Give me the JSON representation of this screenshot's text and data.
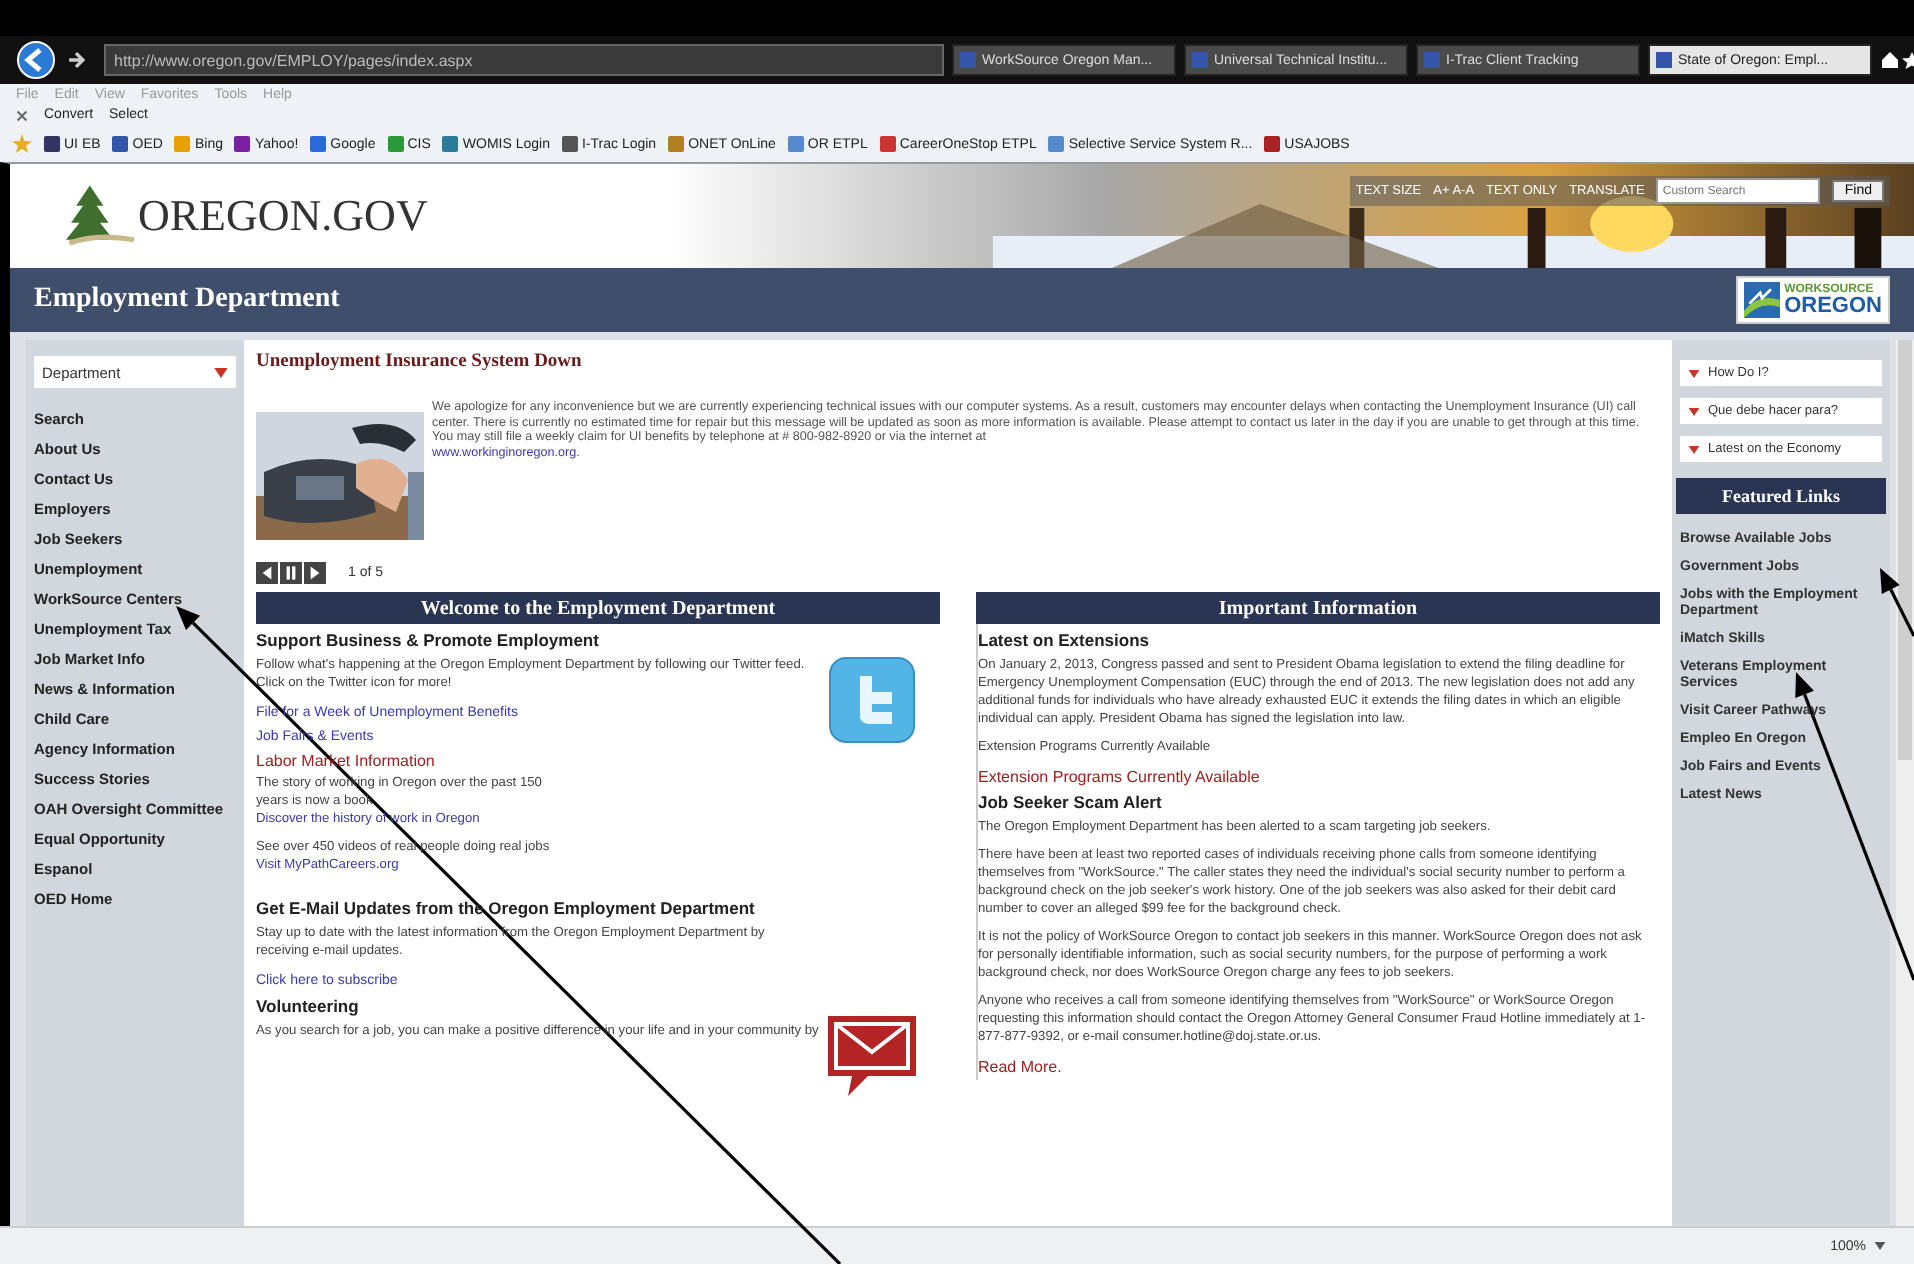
{
  "browser": {
    "address": "http://www.oregon.gov/EMPLOY/pages/index.aspx",
    "tabs": [
      {
        "label": "WorkSource Oregon Man...",
        "selected": false
      },
      {
        "label": "Universal Technical Institu...",
        "selected": false
      },
      {
        "label": "I-Trac Client Tracking",
        "selected": false
      },
      {
        "label": "State of Oregon: Empl...",
        "selected": true
      }
    ],
    "menu": [
      "File",
      "Edit",
      "View",
      "Favorites",
      "Tools",
      "Help"
    ],
    "commands": [
      "Convert",
      "Select"
    ],
    "favorites": [
      "UI EB",
      "OED",
      "Bing",
      "Yahoo!",
      "Google",
      "CIS",
      "WOMIS Login",
      "I-Trac Login",
      "ONET OnLine",
      "OR ETPL",
      "CareerOneStop ETPL",
      "Selective Service System R...",
      "USAJOBS"
    ]
  },
  "header": {
    "logo": "OREGON.GOV",
    "text_size": "TEXT SIZE",
    "size_options": "A+ A-A",
    "text_only": "TEXT ONLY",
    "translate": "TRANSLATE",
    "search_placeholder": "Custom Search",
    "find_button": "Find",
    "banner_title": "Employment Department",
    "badge_top": "WORKSOURCE",
    "badge_bottom": "OREGON"
  },
  "left_nav": {
    "dropdown": "Department",
    "items": [
      "Search",
      "About Us",
      "Contact Us",
      "Employers",
      "Job Seekers",
      "Unemployment",
      "WorkSource Centers",
      "Unemployment Tax",
      "Job Market Info",
      "News & Information",
      "Child Care",
      "Agency Information",
      "Success Stories",
      "OAH Oversight Committee",
      "Equal Opportunity",
      "Espanol",
      "OED Home"
    ]
  },
  "slideshow": {
    "title": "Unemployment Insurance System Down",
    "body": "We apologize for any inconvenience but we are currently experiencing technical issues with our computer systems. As a result, customers may encounter delays when contacting the Unemployment Insurance (UI) call center. There is currently no estimated time for repair but this message will be updated as soon as more information is available. Please attempt to contact us later in the day if you are unable to get through at this time. You may still file a weekly claim for UI benefits by telephone at # 800-982-8920 or via the internet at",
    "link": "www.workinginoregon.org.",
    "counter": "1 of 5"
  },
  "welcome": {
    "title": "Welcome to the Employment Department",
    "blocks": [
      {
        "kind": "heading",
        "text": "Support Business & Promote Employment"
      },
      {
        "kind": "text",
        "text": "Follow what's happening at the Oregon Employment Department by following our Twitter feed. Click on the Twitter icon for more!"
      },
      {
        "kind": "link",
        "text": "File for a Week of Unemployment Benefits"
      },
      {
        "kind": "link",
        "text": "Job Fairs & Events"
      },
      {
        "kind": "hot_link",
        "text": "Labor Market Information"
      },
      {
        "kind": "text_link",
        "text": "The story of working in Oregon over the past 150 years is now a book",
        "link": "Discover the history of work in Oregon"
      },
      {
        "kind": "text_link",
        "text": "See over 450 videos of real people doing real jobs",
        "link": "Visit MyPathCareers.org"
      },
      {
        "kind": "heading",
        "text": "Get E-Mail Updates from the Oregon Employment Department"
      },
      {
        "kind": "text",
        "text": "Stay up to date with the latest information from the Oregon Employment Department by receiving e-mail updates."
      },
      {
        "kind": "link",
        "text": "Click here to subscribe"
      },
      {
        "kind": "heading",
        "text": "Volunteering"
      },
      {
        "kind": "text",
        "text": "As you search for a job, you can make a positive difference in your life and in your community by"
      }
    ]
  },
  "important": {
    "title": "Important Information",
    "blocks": [
      {
        "kind": "heading",
        "text": "Latest on Extensions"
      },
      {
        "kind": "text",
        "text": "On January 2, 2013, Congress passed and sent to President Obama legislation to extend the filing deadline for Emergency Unemployment Compensation (EUC) through the end of 2013. The new legislation does not add any additional funds for individuals who have already exhausted EUC it extends the filing dates in which an eligible individual can apply. President Obama has signed the legislation into law."
      },
      {
        "kind": "text",
        "text": "Extension Programs Currently Available"
      },
      {
        "kind": "hot_link",
        "text": "Extension Programs Currently Available"
      },
      {
        "kind": "heading",
        "text": "Job Seeker Scam Alert"
      },
      {
        "kind": "text",
        "text": "The Oregon Employment Department has been alerted to a scam targeting job seekers."
      },
      {
        "kind": "text",
        "text": "There have been at least two reported cases of individuals receiving phone calls from someone identifying themselves from \"WorkSource.\" The caller states they need the individual's social security number to perform a background check on the job seeker's work history.  One of the job seekers was also asked for their debit card number to cover an alleged $99 fee for the background check."
      },
      {
        "kind": "text",
        "text": "It is not the policy of WorkSource Oregon to contact job seekers in this manner.  WorkSource Oregon does not ask for personally identifiable information, such as social security numbers, for the purpose of performing a work background check, nor does WorkSource Oregon charge any fees to job seekers."
      },
      {
        "kind": "text",
        "text": "Anyone who receives a call from someone identifying themselves from \"WorkSource\" or WorkSource Oregon requesting this information should contact the Oregon Attorney General Consumer Fraud Hotline immediately at 1-877-877-9392, or e-mail consumer.hotline@doj.state.or.us."
      },
      {
        "kind": "hot_link",
        "text": "Read More."
      }
    ]
  },
  "right_nav": {
    "dropdowns": [
      "How Do I?",
      "Que debe hacer para?",
      "Latest on the Economy"
    ],
    "featured_title": "Featured Links",
    "links": [
      "Browse Available Jobs",
      "Government Jobs",
      "Jobs with the Employment Department",
      "iMatch Skills",
      "Veterans Employment Services",
      "Visit Career Pathways",
      "Empleo En Oregon",
      "Job Fairs and Events",
      "Latest News"
    ]
  },
  "status_bar": {
    "zoom": "100%"
  }
}
